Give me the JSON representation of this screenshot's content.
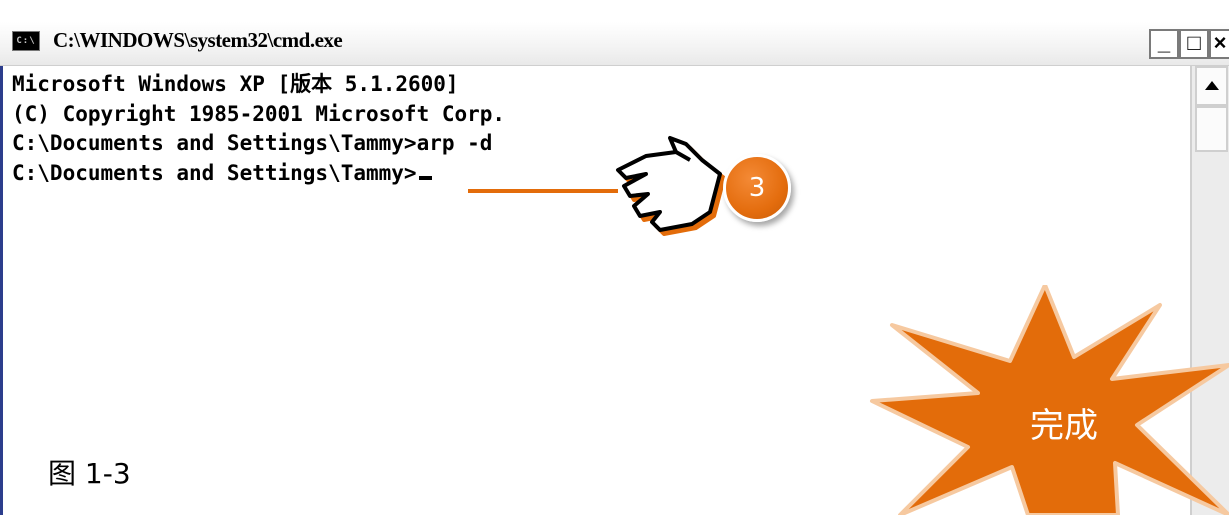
{
  "window": {
    "title": "C:\\WINDOWS\\system32\\cmd.exe",
    "icon_label": "C:\\",
    "controls": {
      "minimize": "_",
      "maximize": "□",
      "close": "×"
    }
  },
  "console": {
    "lines": [
      "Microsoft Windows XP [版本 5.1.2600]",
      "(C) Copyright 1985-2001 Microsoft Corp.",
      "",
      "C:\\Documents and Settings\\Tammy>arp -d",
      "",
      "C:\\Documents and Settings\\Tammy>"
    ]
  },
  "annotations": {
    "step_number": "3",
    "burst_label": "完成",
    "caption": "图 1-3",
    "accent_color": "#e36c0a"
  }
}
